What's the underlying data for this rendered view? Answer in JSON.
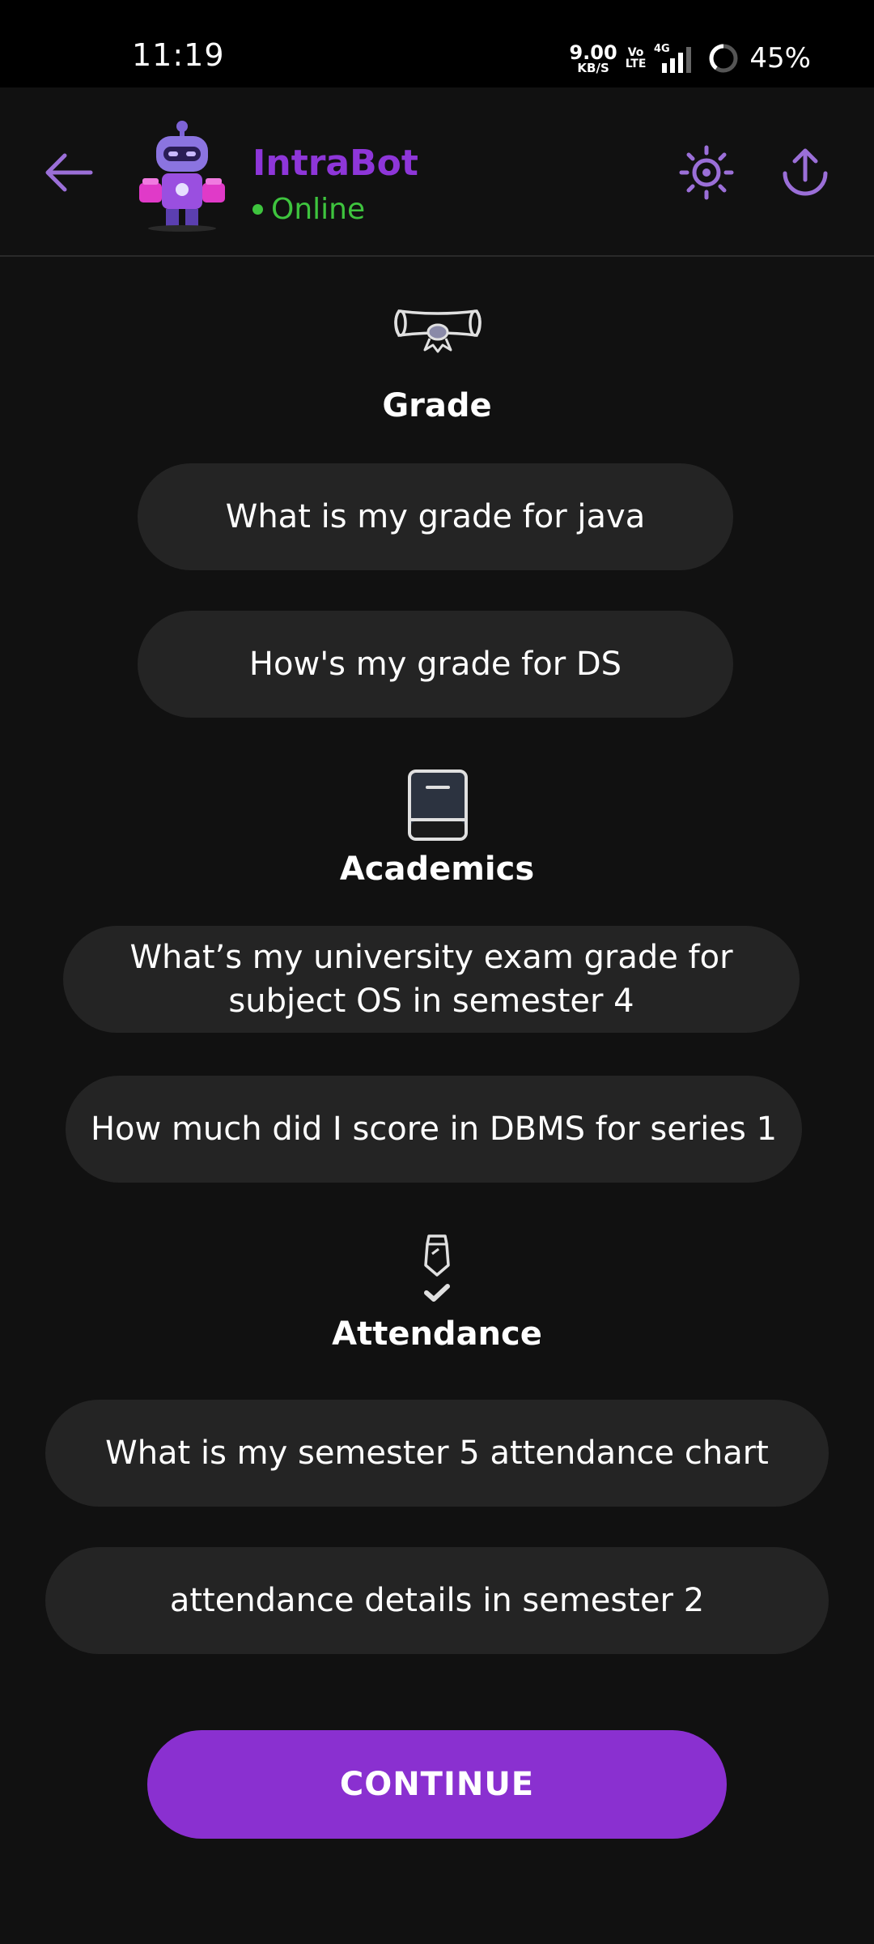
{
  "status_bar": {
    "time": "11:19",
    "net_speed_value": "9.00",
    "net_speed_unit": "KB/S",
    "volte_top": "Vo",
    "volte_bottom": "LTE",
    "network_type": "4G",
    "battery_percent": "45%"
  },
  "header": {
    "bot_name": "IntraBot",
    "bot_status": "Online",
    "icons": [
      "back-arrow-icon",
      "robot-avatar",
      "sun-icon",
      "upload-icon"
    ]
  },
  "sections": [
    {
      "title": "Grade",
      "icon": "diploma-icon",
      "suggestions": [
        "What is my grade for java",
        "How's my grade for DS"
      ]
    },
    {
      "title": "Academics",
      "icon": "book-icon",
      "suggestions": [
        "What’s my university exam grade for subject OS in semester 4",
        "How much did I score in DBMS for series 1"
      ]
    },
    {
      "title": "Attendance",
      "icon": "attendance-tie-check-icon",
      "suggestions": [
        "What is my semester 5 attendance chart",
        "attendance details in semester 2"
      ]
    }
  ],
  "continue_label": "CONTINUE",
  "colors": {
    "background": "#111111",
    "accent": "#8a30d0",
    "online": "#3ec43e",
    "chip": "#242424",
    "icon": "#9b6fd8"
  }
}
